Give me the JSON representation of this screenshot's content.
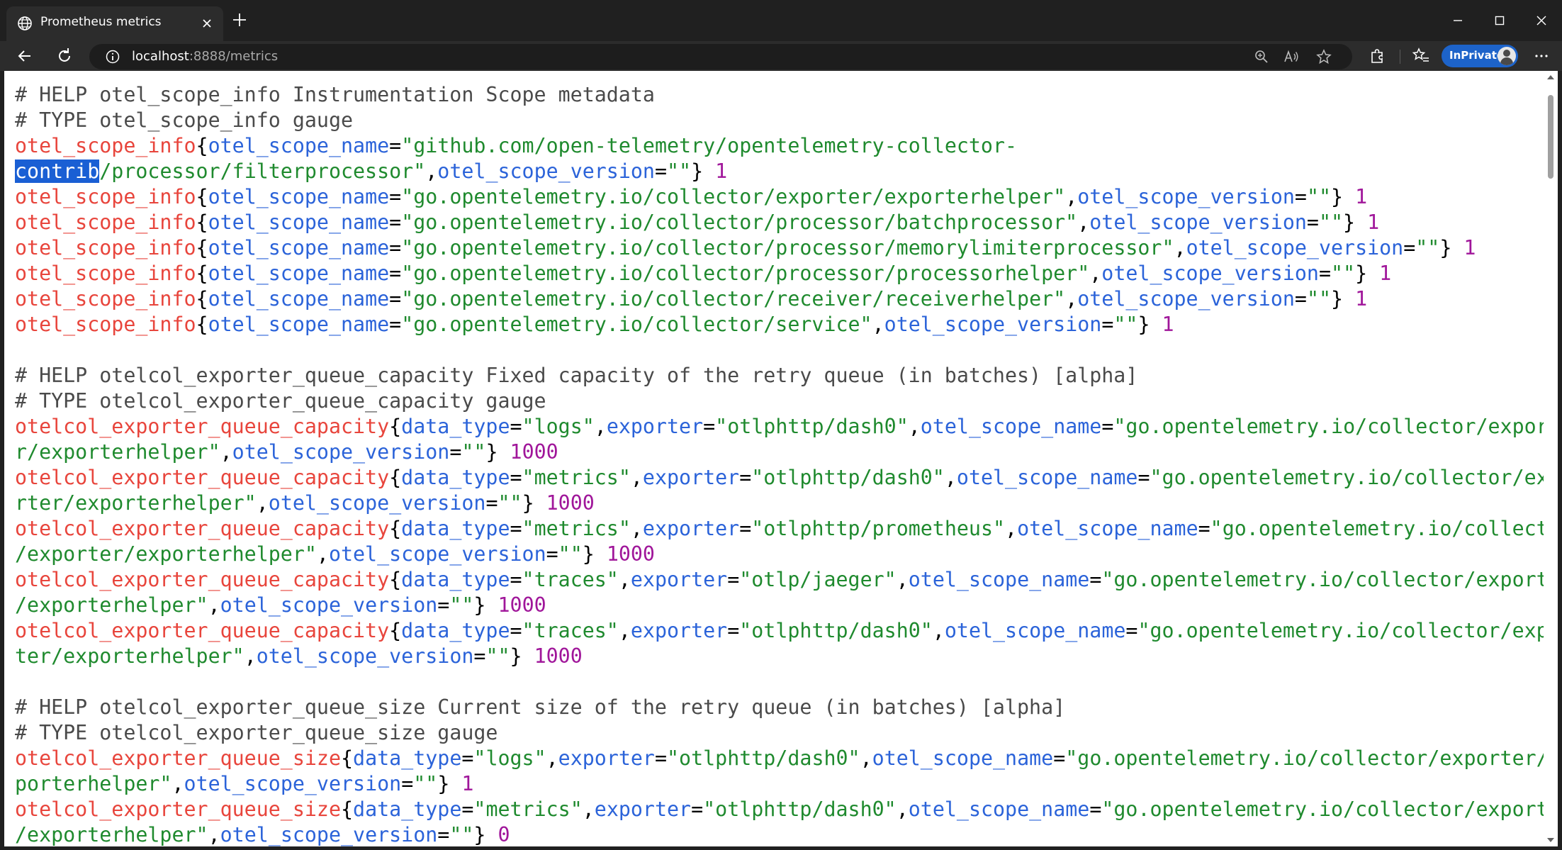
{
  "window": {
    "tab_title": "Prometheus metrics",
    "icons": {
      "tab": "globe-icon",
      "close_tab": "close-icon",
      "new_tab": "plus-icon",
      "minimize": "minimize-icon",
      "maximize": "maximize-icon",
      "close_window": "close-icon"
    }
  },
  "toolbar": {
    "url_host": "localhost",
    "url_rest": ":8888/metrics",
    "inprivate_label": "InPrivate",
    "icons": [
      "back-icon",
      "refresh-icon",
      "info-icon",
      "zoom-icon",
      "read-aloud-icon",
      "favorite-star-icon",
      "extensions-icon",
      "favorites-icon",
      "more-icon"
    ]
  },
  "content": {
    "lines": [
      {
        "t": "c",
        "text": "# HELP otel_scope_info Instrumentation Scope metadata"
      },
      {
        "t": "c",
        "text": "# TYPE otel_scope_info gauge"
      },
      {
        "t": "wrap1a",
        "metric": "otel_scope_info",
        "k1": "otel_scope_name",
        "v1": "github.com/open-telemetry/opentelemetry-collector-"
      },
      {
        "t": "wrap1b",
        "sel": "contrib",
        "v1rest": "/processor/filterprocessor",
        "k2": "otel_scope_version",
        "v2": "",
        "num": "1"
      },
      {
        "t": "m2",
        "metric": "otel_scope_info",
        "k1": "otel_scope_name",
        "v1": "go.opentelemetry.io/collector/exporter/exporterhelper",
        "k2": "otel_scope_version",
        "v2": "",
        "num": "1"
      },
      {
        "t": "m2",
        "metric": "otel_scope_info",
        "k1": "otel_scope_name",
        "v1": "go.opentelemetry.io/collector/processor/batchprocessor",
        "k2": "otel_scope_version",
        "v2": "",
        "num": "1"
      },
      {
        "t": "m2",
        "metric": "otel_scope_info",
        "k1": "otel_scope_name",
        "v1": "go.opentelemetry.io/collector/processor/memorylimiterprocessor",
        "k2": "otel_scope_version",
        "v2": "",
        "num": "1"
      },
      {
        "t": "m2",
        "metric": "otel_scope_info",
        "k1": "otel_scope_name",
        "v1": "go.opentelemetry.io/collector/processor/processorhelper",
        "k2": "otel_scope_version",
        "v2": "",
        "num": "1"
      },
      {
        "t": "m2",
        "metric": "otel_scope_info",
        "k1": "otel_scope_name",
        "v1": "go.opentelemetry.io/collector/receiver/receiverhelper",
        "k2": "otel_scope_version",
        "v2": "",
        "num": "1"
      },
      {
        "t": "m2",
        "metric": "otel_scope_info",
        "k1": "otel_scope_name",
        "v1": "go.opentelemetry.io/collector/service",
        "k2": "otel_scope_version",
        "v2": "",
        "num": "1"
      },
      {
        "t": "blank"
      },
      {
        "t": "c",
        "text": "# HELP otelcol_exporter_queue_capacity Fixed capacity of the retry queue (in batches) [alpha]"
      },
      {
        "t": "c",
        "text": "# TYPE otelcol_exporter_queue_capacity gauge"
      },
      {
        "t": "w4a",
        "metric": "otelcol_exporter_queue_capacity",
        "k1": "data_type",
        "v1": "logs",
        "k2": "exporter",
        "v2": "otlphttp/dash0",
        "k3": "otel_scope_name",
        "v3": "go.opentelemetry.io/collector/exporte"
      },
      {
        "t": "w4b",
        "v3rest": "r/exporterhelper",
        "k4": "otel_scope_version",
        "v4": "",
        "num": "1000"
      },
      {
        "t": "w4a",
        "metric": "otelcol_exporter_queue_capacity",
        "k1": "data_type",
        "v1": "metrics",
        "k2": "exporter",
        "v2": "otlphttp/dash0",
        "k3": "otel_scope_name",
        "v3": "go.opentelemetry.io/collector/expo"
      },
      {
        "t": "w4b",
        "v3rest": "rter/exporterhelper",
        "k4": "otel_scope_version",
        "v4": "",
        "num": "1000"
      },
      {
        "t": "w4a",
        "metric": "otelcol_exporter_queue_capacity",
        "k1": "data_type",
        "v1": "metrics",
        "k2": "exporter",
        "v2": "otlphttp/prometheus",
        "k3": "otel_scope_name",
        "v3": "go.opentelemetry.io/collector"
      },
      {
        "t": "w4b",
        "v3rest": "/exporter/exporterhelper",
        "k4": "otel_scope_version",
        "v4": "",
        "num": "1000"
      },
      {
        "t": "w4a",
        "metric": "otelcol_exporter_queue_capacity",
        "k1": "data_type",
        "v1": "traces",
        "k2": "exporter",
        "v2": "otlp/jaeger",
        "k3": "otel_scope_name",
        "v3": "go.opentelemetry.io/collector/exporter"
      },
      {
        "t": "w4b",
        "v3rest": "/exporterhelper",
        "k4": "otel_scope_version",
        "v4": "",
        "num": "1000"
      },
      {
        "t": "w4a",
        "metric": "otelcol_exporter_queue_capacity",
        "k1": "data_type",
        "v1": "traces",
        "k2": "exporter",
        "v2": "otlphttp/dash0",
        "k3": "otel_scope_name",
        "v3": "go.opentelemetry.io/collector/expor"
      },
      {
        "t": "w4b",
        "v3rest": "ter/exporterhelper",
        "k4": "otel_scope_version",
        "v4": "",
        "num": "1000"
      },
      {
        "t": "blank"
      },
      {
        "t": "c",
        "text": "# HELP otelcol_exporter_queue_size Current size of the retry queue (in batches) [alpha]"
      },
      {
        "t": "c",
        "text": "# TYPE otelcol_exporter_queue_size gauge"
      },
      {
        "t": "w4a",
        "metric": "otelcol_exporter_queue_size",
        "k1": "data_type",
        "v1": "logs",
        "k2": "exporter",
        "v2": "otlphttp/dash0",
        "k3": "otel_scope_name",
        "v3": "go.opentelemetry.io/collector/exporter/ex"
      },
      {
        "t": "w4b",
        "v3rest": "porterhelper",
        "k4": "otel_scope_version",
        "v4": "",
        "num": "1"
      },
      {
        "t": "w4a",
        "metric": "otelcol_exporter_queue_size",
        "k1": "data_type",
        "v1": "metrics",
        "k2": "exporter",
        "v2": "otlphttp/dash0",
        "k3": "otel_scope_name",
        "v3": "go.opentelemetry.io/collector/exporter"
      },
      {
        "t": "w4b",
        "v3rest": "/exporterhelper",
        "k4": "otel_scope_version",
        "v4": "",
        "num": "0"
      }
    ]
  }
}
